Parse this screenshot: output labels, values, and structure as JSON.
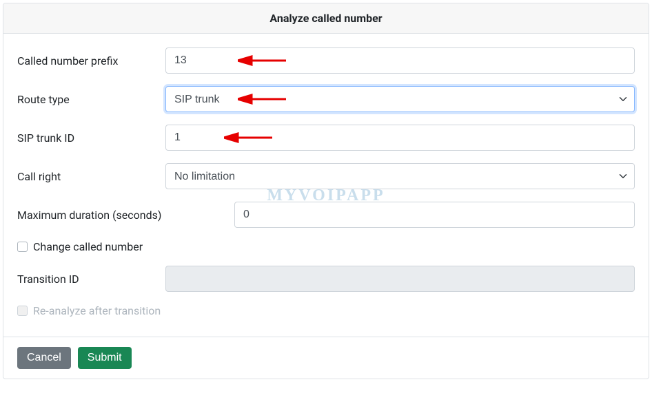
{
  "header": {
    "title": "Analyze called number"
  },
  "watermark": "MYVOIPAPP",
  "fields": {
    "calledNumberPrefix": {
      "label": "Called number prefix",
      "value": "13"
    },
    "routeType": {
      "label": "Route type",
      "value": "SIP trunk"
    },
    "sipTrunkId": {
      "label": "SIP trunk ID",
      "value": "1"
    },
    "callRight": {
      "label": "Call right",
      "value": "No limitation"
    },
    "maxDuration": {
      "label": "Maximum duration (seconds)",
      "value": "0"
    },
    "changeCalledNumber": {
      "label": "Change called number"
    },
    "transitionId": {
      "label": "Transition ID",
      "value": ""
    },
    "reanalyze": {
      "label": "Re-analyze after transition"
    }
  },
  "footer": {
    "cancel": "Cancel",
    "submit": "Submit"
  }
}
